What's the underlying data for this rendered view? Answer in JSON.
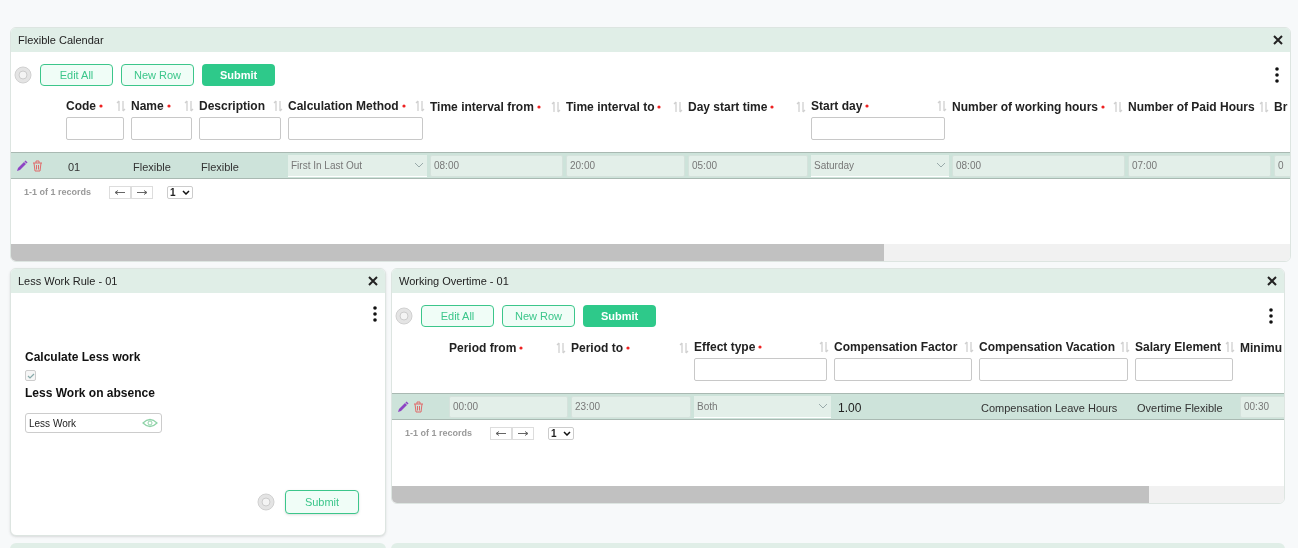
{
  "calendar_panel": {
    "title": "Flexible Calendar",
    "buttons": [
      {
        "label": "Edit All",
        "kind": "outline"
      },
      {
        "label": "New Row",
        "kind": "outline"
      },
      {
        "label": "Submit",
        "kind": "solid"
      }
    ],
    "columns": [
      {
        "label": "Code",
        "required": true,
        "sort": true,
        "filter": true
      },
      {
        "label": "Name",
        "required": true,
        "sort": true,
        "filter": true
      },
      {
        "label": "Description",
        "required": false,
        "sort": true,
        "filter": true
      },
      {
        "label": "Calculation Method",
        "required": true,
        "sort": true,
        "filter": true
      },
      {
        "label": "Time interval from",
        "required": true,
        "sort": true,
        "filter": false
      },
      {
        "label": "Time interval to",
        "required": true,
        "sort": true,
        "filter": false
      },
      {
        "label": "Day start time",
        "required": true,
        "sort": true,
        "filter": false
      },
      {
        "label": "Start day",
        "required": true,
        "sort": true,
        "filter": true
      },
      {
        "label": "Number of working hours",
        "required": true,
        "sort": true,
        "filter": false
      },
      {
        "label": "Number of Paid Hours",
        "required": false,
        "sort": true,
        "filter": false
      },
      {
        "label": "Br",
        "required": false,
        "sort": false,
        "filter": false
      }
    ],
    "rows": [
      {
        "cells": [
          {
            "kind": "text",
            "value": "01"
          },
          {
            "kind": "text",
            "value": "Flexible"
          },
          {
            "kind": "text",
            "value": "Flexible"
          },
          {
            "kind": "select",
            "value": "First In Last Out"
          },
          {
            "kind": "input",
            "value": "08:00"
          },
          {
            "kind": "input",
            "value": "20:00"
          },
          {
            "kind": "input",
            "value": "05:00"
          },
          {
            "kind": "select",
            "value": "Saturday"
          },
          {
            "kind": "input",
            "value": "08:00"
          },
          {
            "kind": "input",
            "value": "07:00"
          },
          {
            "kind": "input",
            "value": "0"
          }
        ]
      }
    ],
    "records": "1-1 of 1 records",
    "page": "1"
  },
  "less_work_panel": {
    "title": "Less Work Rule - 01",
    "checkbox_label": "Calculate Less work",
    "checked": true,
    "field_label": "Less Work on absence",
    "field_value": "Less Work",
    "submit": "Submit"
  },
  "overtime_panel": {
    "title": "Working Overtime - 01",
    "buttons": [
      {
        "label": "Edit All",
        "kind": "outline"
      },
      {
        "label": "New Row",
        "kind": "outline"
      },
      {
        "label": "Submit",
        "kind": "solid"
      }
    ],
    "columns": [
      {
        "label": "Period from",
        "required": true,
        "sort": true,
        "filter": false
      },
      {
        "label": "Period to",
        "required": true,
        "sort": true,
        "filter": false
      },
      {
        "label": "Effect type",
        "required": true,
        "sort": true,
        "filter": true
      },
      {
        "label": "Compensation Factor",
        "required": false,
        "sort": true,
        "filter": true
      },
      {
        "label": "Compensation Vacation",
        "required": false,
        "sort": true,
        "filter": true
      },
      {
        "label": "Salary Element",
        "required": false,
        "sort": true,
        "filter": true
      },
      {
        "label": "Minimu",
        "required": false,
        "sort": false,
        "filter": false
      }
    ],
    "rows": [
      {
        "cells": [
          {
            "kind": "input",
            "value": "00:00"
          },
          {
            "kind": "input",
            "value": "23:00"
          },
          {
            "kind": "select",
            "value": "Both"
          },
          {
            "kind": "number",
            "value": "1.00"
          },
          {
            "kind": "text",
            "value": "Compensation Leave Hours"
          },
          {
            "kind": "text",
            "value": "Overtime Flexible"
          },
          {
            "kind": "input",
            "value": "00:30"
          }
        ]
      }
    ],
    "records": "1-1 of 1 records",
    "page": "1"
  }
}
